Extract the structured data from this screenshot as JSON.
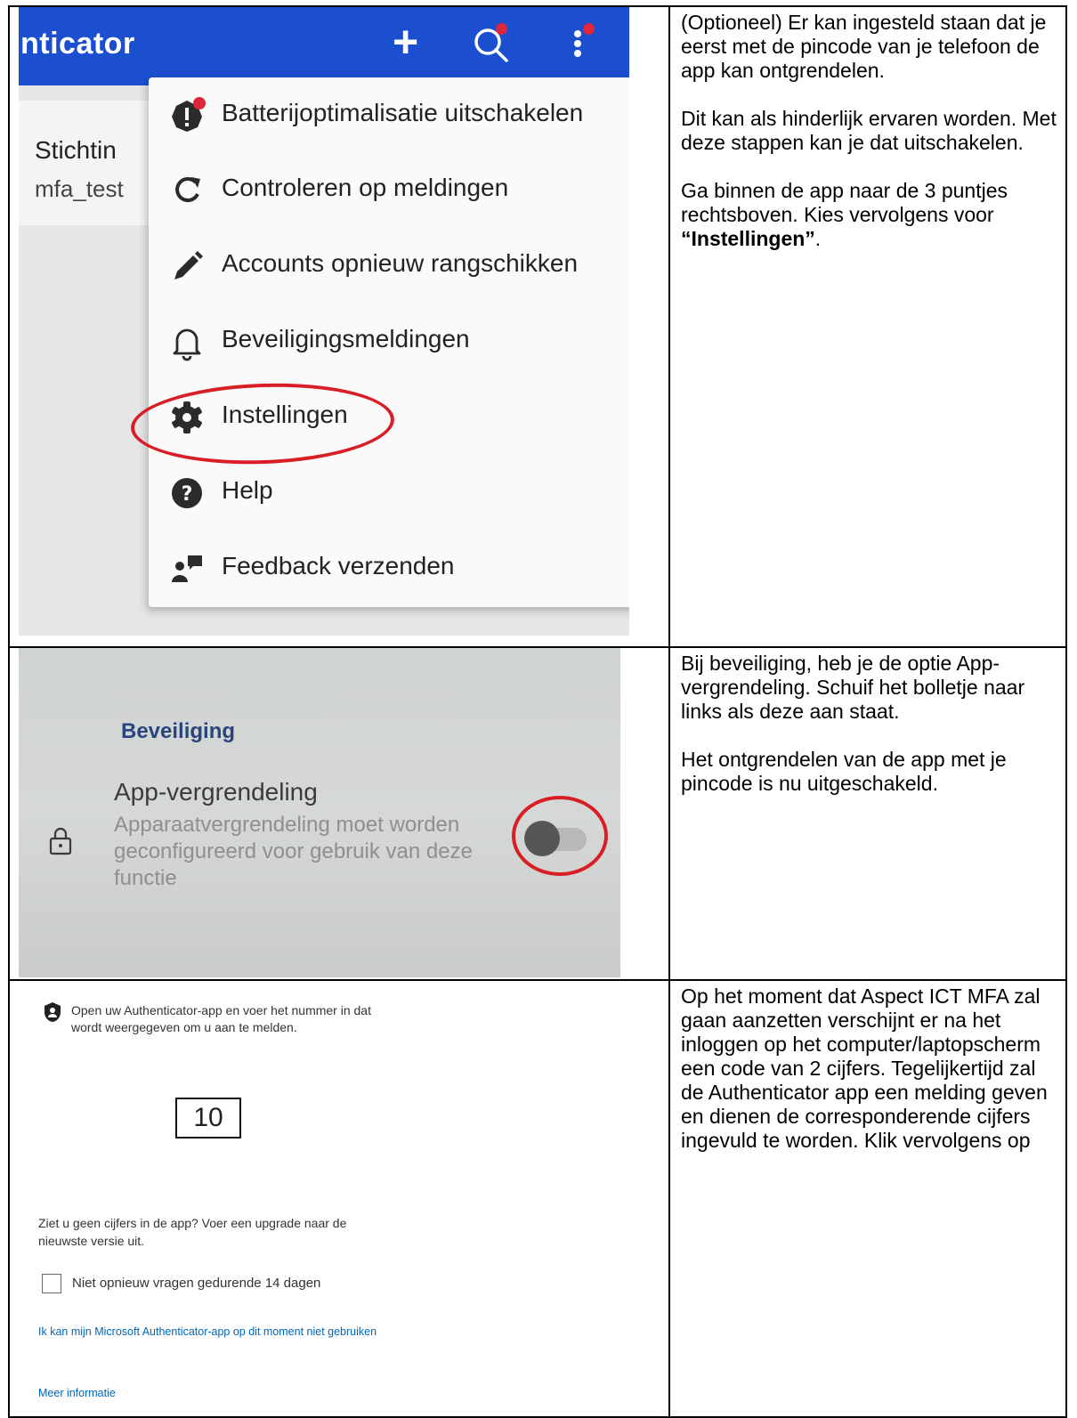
{
  "row1": {
    "app_title": "nticator",
    "card": {
      "name": "Stichtin",
      "subtitle": "mfa_test"
    },
    "menu_items": [
      {
        "icon": "battery-alert-icon",
        "label": "Batterijoptimalisatie uitschakelen"
      },
      {
        "icon": "refresh-icon",
        "label": "Controleren op meldingen"
      },
      {
        "icon": "pencil-icon",
        "label": "Accounts opnieuw rangschikken"
      },
      {
        "icon": "bell-icon",
        "label": "Beveiligingsmeldingen"
      },
      {
        "icon": "gear-icon",
        "label": "Instellingen"
      },
      {
        "icon": "help-icon",
        "label": "Help"
      },
      {
        "icon": "feedback-icon",
        "label": "Feedback verzenden"
      }
    ],
    "note": {
      "p1": "(Optioneel) Er kan ingesteld staan dat je eerst met de pincode van je telefoon de app kan ontgrendelen.",
      "p2": "Dit kan als hinderlijk ervaren worden. Met deze stappen kan je dat uitschakelen.",
      "p3_before": "Ga binnen de app naar de 3 puntjes rechtsboven. Kies vervolgens voor ",
      "p3_bold": "“Instellingen”",
      "p3_after": "."
    }
  },
  "row2": {
    "section_heading": "Beveiliging",
    "setting_title": "App-vergrendeling",
    "setting_description": "Apparaatvergrendeling moet worden geconfigureerd voor gebruik van deze functie",
    "toggle_on": false,
    "note": {
      "p1": "Bij beveiliging, heb je de optie App-vergrendeling. Schuif het bolletje naar links als deze aan staat.",
      "p2": "Het ontgrendelen van de app met je pincode is nu uitgeschakeld."
    }
  },
  "row3": {
    "prompt": "Open uw Authenticator-app en voer het nummer in dat wordt weergegeven om u aan te melden.",
    "code": "10",
    "upgrade_hint": "Ziet u geen cijfers in de app? Voer een upgrade naar de nieuwste versie uit.",
    "remember_checkbox": "Niet opnieuw vragen gedurende 14 dagen",
    "remember_checked": false,
    "link_cant_use": "Ik kan mijn Microsoft Authenticator-app op dit moment niet gebruiken",
    "link_more_info": "Meer informatie",
    "note": {
      "p1": "Op het moment dat Aspect ICT MFA zal gaan aanzetten verschijnt er na het inloggen op het computer/laptopscherm een code van 2 cijfers. Tegelijkertijd zal de Authenticator app een melding geven en dienen de corresponderende cijfers ingevuld te worden. Klik vervolgens op"
    }
  },
  "colors": {
    "appbar_blue": "#1c4fd0",
    "notification_red": "#e0263a",
    "highlight_red": "#d81f26",
    "heading_blue": "#2a4480",
    "link_blue": "#0067b8"
  }
}
